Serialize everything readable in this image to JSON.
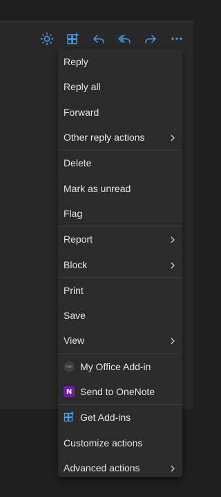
{
  "toolbar": {
    "buttons": [
      {
        "icon": "brightness-icon",
        "name": "theme-toggle-button"
      },
      {
        "icon": "apps-add-icon",
        "name": "apps-button"
      },
      {
        "icon": "reply-icon",
        "name": "reply-button"
      },
      {
        "icon": "reply-all-icon",
        "name": "reply-all-button"
      },
      {
        "icon": "forward-icon",
        "name": "forward-button"
      },
      {
        "icon": "more-icon",
        "name": "more-actions-button"
      }
    ],
    "accent": "#479ef5"
  },
  "menu": {
    "group1": {
      "reply": "Reply",
      "reply_all": "Reply all",
      "forward": "Forward",
      "other_reply": "Other reply actions"
    },
    "group2": {
      "delete": "Delete",
      "mark_unread": "Mark as unread",
      "flag": "Flag"
    },
    "group3": {
      "report": "Report",
      "block": "Block"
    },
    "group4": {
      "print": "Print",
      "save": "Save",
      "view": "View"
    },
    "group5": {
      "my_addin": "My Office Add-in",
      "my_addin_logo_text": "Logo",
      "onenote": "Send to OneNote",
      "onenote_letter": "N"
    },
    "group6": {
      "get_addins": "Get Add-ins",
      "customize": "Customize actions",
      "advanced": "Advanced actions"
    }
  },
  "colors": {
    "background": "#1f1f1f",
    "menu_bg": "#2b2b2b",
    "text": "#e6e6e6",
    "onenote_purple": "#7719aa"
  }
}
